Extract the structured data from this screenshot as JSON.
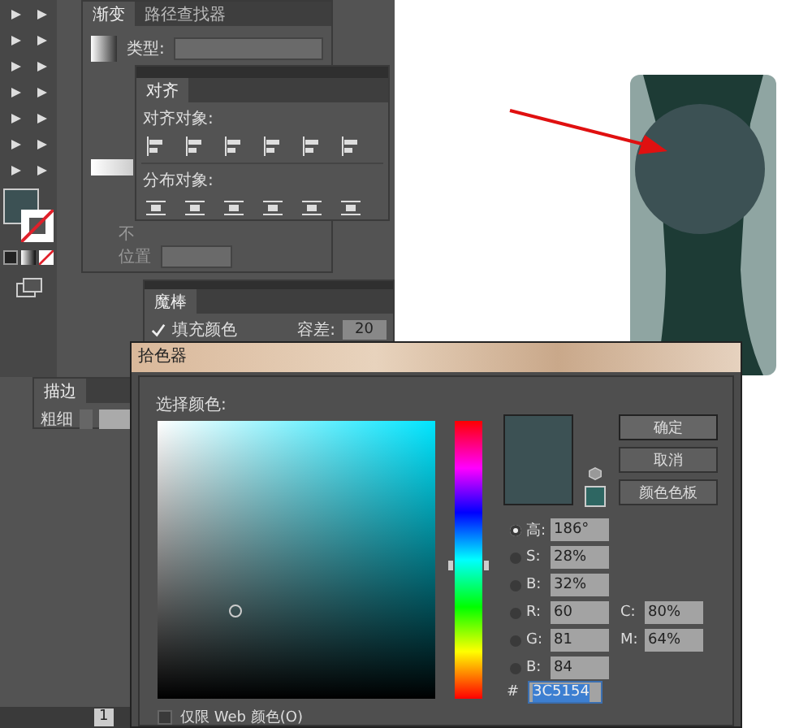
{
  "gradient_panel": {
    "tabs": [
      {
        "label": "渐变",
        "selected": true
      },
      {
        "label": "路径查找器",
        "selected": false
      }
    ],
    "type_label": "类型:",
    "opacity_label": "不",
    "location_label": "位置"
  },
  "align_panel": {
    "tabs": [
      {
        "label": "对齐",
        "selected": true
      }
    ],
    "align_label": "对齐对象:",
    "distribute_label": "分布对象:"
  },
  "magic_wand_panel": {
    "tabs": [
      {
        "label": "魔棒",
        "selected": true
      }
    ],
    "fill_color": {
      "label": "填充颜色",
      "checked": true
    },
    "tolerance_label": "容差:",
    "tolerance_value": "20"
  },
  "stroke_panel": {
    "tabs": [
      {
        "label": "描边",
        "selected": true
      }
    ],
    "weight_label": "粗细"
  },
  "color_picker": {
    "title": "拾色器",
    "prompt": "选择颜色:",
    "hue_slider": {
      "level": 0.52
    },
    "buttons": [
      "确定",
      "取消",
      "颜色色板"
    ],
    "fields": [
      {
        "label": "高:",
        "value": "186°",
        "selected": true
      },
      {
        "label": "S:",
        "value": "28%",
        "selected": false
      },
      {
        "label": "B:",
        "value": "32%",
        "selected": false
      },
      {
        "label": "R:",
        "value": "60",
        "selected": false
      },
      {
        "label": "G:",
        "value": "81",
        "selected": false
      },
      {
        "label": "B:",
        "value": "84",
        "selected": false
      }
    ],
    "cmyk_fields": [
      {
        "label": "C:",
        "value": "80%"
      },
      {
        "label": "M:",
        "value": "64%"
      }
    ],
    "hex_label": "#",
    "hex_value": "3C5154",
    "web_only": {
      "label": "仅限 Web 颜色(O)",
      "checked": false
    }
  },
  "status_bar": {
    "page": "1"
  }
}
